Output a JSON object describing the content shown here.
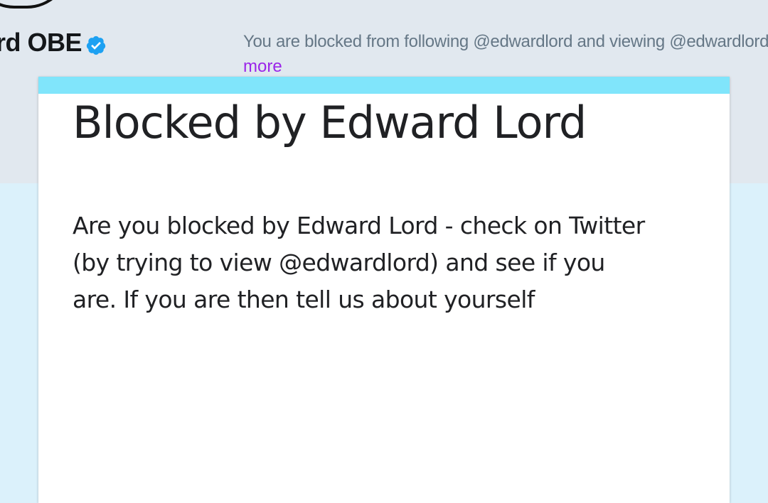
{
  "profile": {
    "name_visible": "rd OBE",
    "verified_icon": "verified-badge-icon",
    "blocked_message": "You are blocked from following @edwardlord and viewing @edwardlord's Tweets.",
    "more_link": "more"
  },
  "form": {
    "title": "Blocked by Edward Lord",
    "description": "Are you blocked by Edward Lord - check on Twitter (by trying to view @edwardlord) and see if you are. If you are then tell us about yourself"
  },
  "colors": {
    "header_bg": "#e1e8ef",
    "page_bg": "#dbf1fb",
    "card_accent": "#80e5fb",
    "verified_blue": "#1da1f2",
    "link_purple": "#9b26e9",
    "text_dark": "#202124",
    "text_muted": "#657786"
  }
}
